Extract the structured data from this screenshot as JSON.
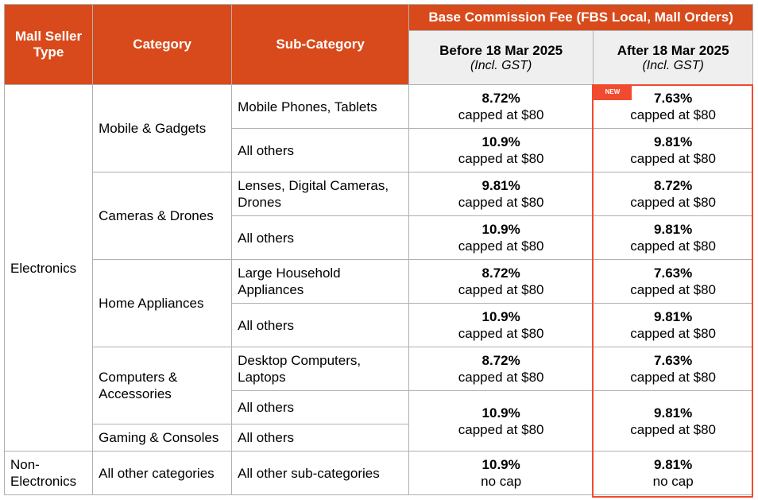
{
  "header": {
    "seller_type": "Mall Seller Type",
    "category": "Category",
    "sub_category": "Sub-Category",
    "fee_group": "Base Commission Fee (FBS Local, Mall Orders)",
    "before": "Before 18 Mar 2025",
    "after": "After 18 Mar 2025",
    "gst": "(Incl. GST)"
  },
  "badge": "NEW",
  "accent_color": "#d84a1b",
  "highlight_color": "#f24a2e",
  "seller_types": [
    "Electronics",
    "Non-Electronics"
  ],
  "categories": [
    "Mobile & Gadgets",
    "Cameras & Drones",
    "Home Appliances",
    "Computers & Accessories",
    "Gaming & Consoles",
    "All other categories"
  ],
  "rows": [
    {
      "sub": "Mobile Phones, Tablets",
      "before": "8.72%",
      "before_cap": "capped at $80",
      "after": "7.63%",
      "after_cap": "capped at $80"
    },
    {
      "sub": "All others",
      "before": "10.9%",
      "before_cap": "capped at $80",
      "after": "9.81%",
      "after_cap": "capped at $80"
    },
    {
      "sub": "Lenses, Digital Cameras, Drones",
      "before": "9.81%",
      "before_cap": "capped at $80",
      "after": "8.72%",
      "after_cap": "capped at $80"
    },
    {
      "sub": "All others",
      "before": "10.9%",
      "before_cap": "capped at $80",
      "after": "9.81%",
      "after_cap": "capped at $80"
    },
    {
      "sub": "Large Household Appliances",
      "before": "8.72%",
      "before_cap": "capped at $80",
      "after": "7.63%",
      "after_cap": "capped at $80"
    },
    {
      "sub": "All others",
      "before": "10.9%",
      "before_cap": "capped at $80",
      "after": "9.81%",
      "after_cap": "capped at $80"
    },
    {
      "sub": "Desktop Computers, Laptops",
      "before": "8.72%",
      "before_cap": "capped at $80",
      "after": "7.63%",
      "after_cap": "capped at $80"
    },
    {
      "sub": "All others",
      "before": "10.9%",
      "before_cap": "capped at $80",
      "after": "9.81%",
      "after_cap": "capped at $80"
    },
    {
      "sub": "All others"
    },
    {
      "sub": "All other sub-categories",
      "before": "10.9%",
      "before_cap": "no cap",
      "after": "9.81%",
      "after_cap": "no cap"
    }
  ]
}
